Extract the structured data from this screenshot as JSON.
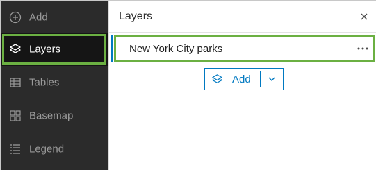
{
  "sidebar": {
    "items": [
      {
        "label": "Add",
        "icon": "add-circle-icon"
      },
      {
        "label": "Layers",
        "icon": "layers-icon",
        "active": true
      },
      {
        "label": "Tables",
        "icon": "table-icon"
      },
      {
        "label": "Basemap",
        "icon": "basemap-icon"
      },
      {
        "label": "Legend",
        "icon": "legend-icon"
      }
    ]
  },
  "panel": {
    "title": "Layers",
    "close_icon": "close-icon",
    "layers": [
      {
        "name": "New York City parks",
        "menu_icon": "more-options-icon"
      }
    ],
    "add_button": {
      "label": "Add",
      "icon": "layers-icon",
      "dropdown_icon": "chevron-down-icon"
    }
  },
  "colors": {
    "sidebar_bg": "#2b2b2b",
    "active_bg": "#151515",
    "highlight_outline": "#6bb042",
    "accent_blue": "#0079c1"
  }
}
